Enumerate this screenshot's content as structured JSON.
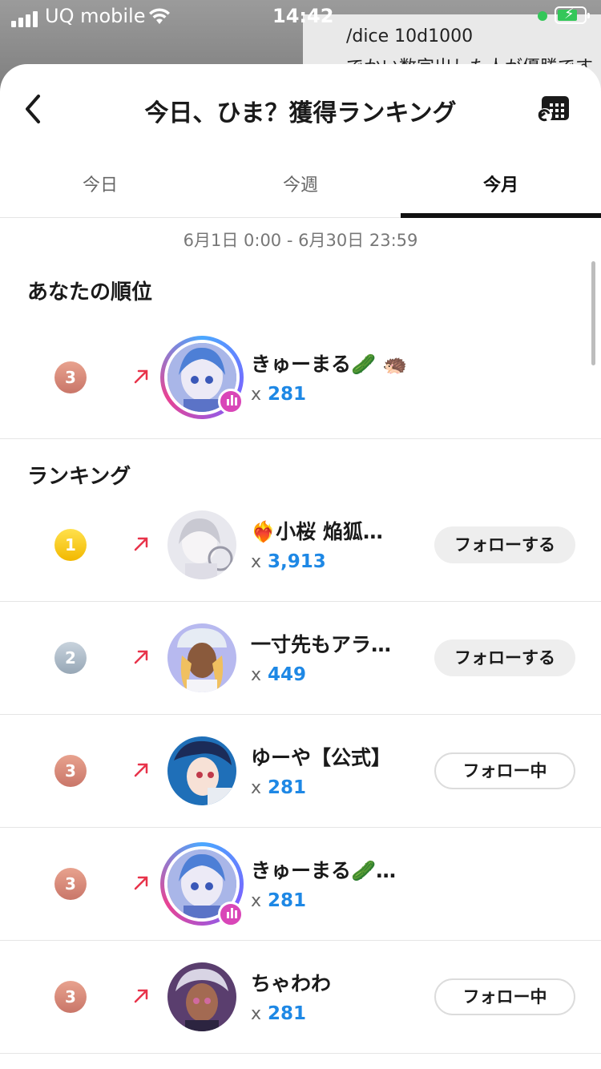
{
  "status_bar": {
    "carrier": "UQ mobile",
    "time": "14:42"
  },
  "background_chat": {
    "line1": "/dice 10d1000",
    "line2": "でかい数字出した人が優勝です"
  },
  "header": {
    "title": "今日、ひま？獲得ランキング"
  },
  "tabs": [
    {
      "label": "今日"
    },
    {
      "label": "今週"
    },
    {
      "label": "今月",
      "active": true
    }
  ],
  "date_range": "6月1日 0:00 - 6月30日 23:59",
  "my_rank": {
    "heading": "あなたの順位",
    "rank": "3",
    "name": "きゅーまる",
    "name_emoji": "🥒 🦔",
    "prefix": "x",
    "count": "281"
  },
  "ranking": {
    "heading": "ランキング",
    "items": [
      {
        "rank": "1",
        "name_emoji": "❤️‍🔥",
        "name": "小桜 焔狐…",
        "prefix": "x",
        "count": "3,913",
        "button": "フォローする",
        "following": false
      },
      {
        "rank": "2",
        "name_emoji": "",
        "name": "一寸先もアラ…",
        "prefix": "x",
        "count": "449",
        "button": "フォローする",
        "following": false
      },
      {
        "rank": "3",
        "name_emoji": "",
        "name": "ゆーや【公式】",
        "prefix": "x",
        "count": "281",
        "button": "フォロー中",
        "following": true
      },
      {
        "rank": "3",
        "name_emoji": "",
        "name": "きゅーまる🥒…",
        "prefix": "x",
        "count": "281",
        "button": "",
        "following": false
      },
      {
        "rank": "3",
        "name_emoji": "",
        "name": "ちゃわわ",
        "prefix": "x",
        "count": "281",
        "button": "フォロー中",
        "following": true
      }
    ]
  },
  "colors": {
    "accent_blue": "#1e88e5",
    "up_arrow": "#e8334a",
    "gold": "#f2b800",
    "silver": "#97a7b6",
    "bronze": "#c97669"
  }
}
